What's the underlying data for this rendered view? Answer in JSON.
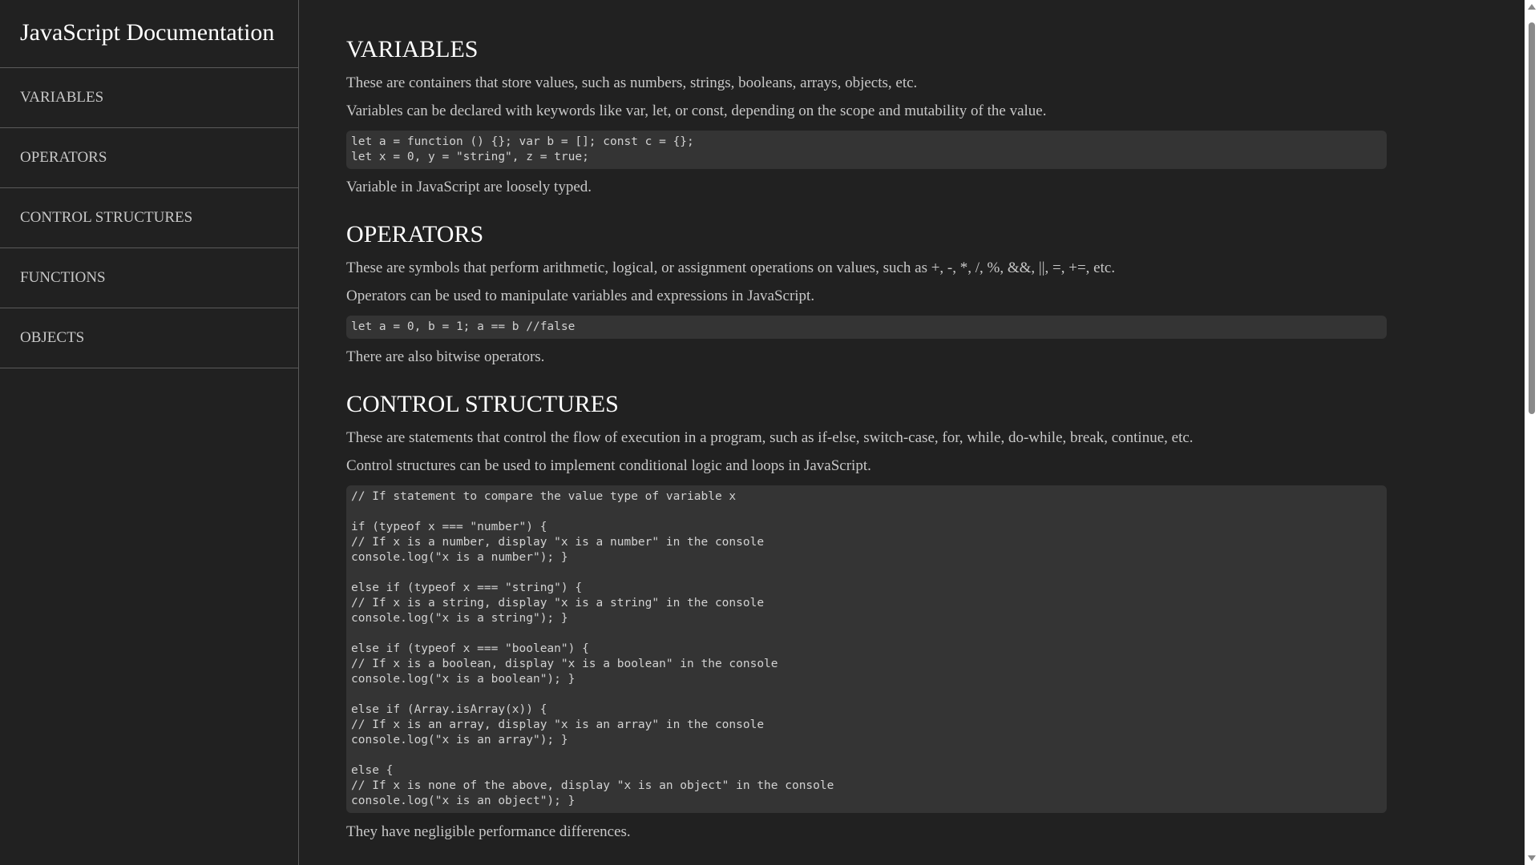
{
  "sidebar": {
    "title": "JavaScript Documentation",
    "items": [
      {
        "label": "VARIABLES"
      },
      {
        "label": "OPERATORS"
      },
      {
        "label": "CONTROL STRUCTURES"
      },
      {
        "label": "FUNCTIONS"
      },
      {
        "label": "OBJECTS"
      }
    ]
  },
  "sections": {
    "variables": {
      "title": "VARIABLES",
      "p1": "These are containers that store values, such as numbers, strings, booleans, arrays, objects, etc.",
      "p2": "Variables can be declared with keywords like var, let, or const, depending on the scope and mutability of the value.",
      "code": "let a = function () {}; var b = []; const c = {};\nlet x = 0, y = \"string\", z = true;",
      "p3": "Variable in JavaScript are loosely typed."
    },
    "operators": {
      "title": "OPERATORS",
      "p1": "These are symbols that perform arithmetic, logical, or assignment operations on values, such as +, -, *, /, %, &&, ||, =, +=, etc.",
      "p2": "Operators can be used to manipulate variables and expressions in JavaScript.",
      "code": "let a = 0, b = 1; a == b //false",
      "p3": "There are also bitwise operators."
    },
    "control": {
      "title": "CONTROL STRUCTURES",
      "p1": "These are statements that control the flow of execution in a program, such as if-else, switch-case, for, while, do-while, break, continue, etc.",
      "p2": "Control structures can be used to implement conditional logic and loops in JavaScript.",
      "code": "// If statement to compare the value type of variable x\n\nif (typeof x === \"number\") {\n// If x is a number, display \"x is a number\" in the console\nconsole.log(\"x is a number\"); }\n\nelse if (typeof x === \"string\") {\n// If x is a string, display \"x is a string\" in the console\nconsole.log(\"x is a string\"); }\n\nelse if (typeof x === \"boolean\") {\n// If x is a boolean, display \"x is a boolean\" in the console\nconsole.log(\"x is a boolean\"); }\n\nelse if (Array.isArray(x)) {\n// If x is an array, display \"x is an array\" in the console\nconsole.log(\"x is an array\"); }\n\nelse {\n// If x is none of the above, display \"x is an object\" in the console\nconsole.log(\"x is an object\"); }",
      "p3": "They have negligible performance differences."
    }
  }
}
